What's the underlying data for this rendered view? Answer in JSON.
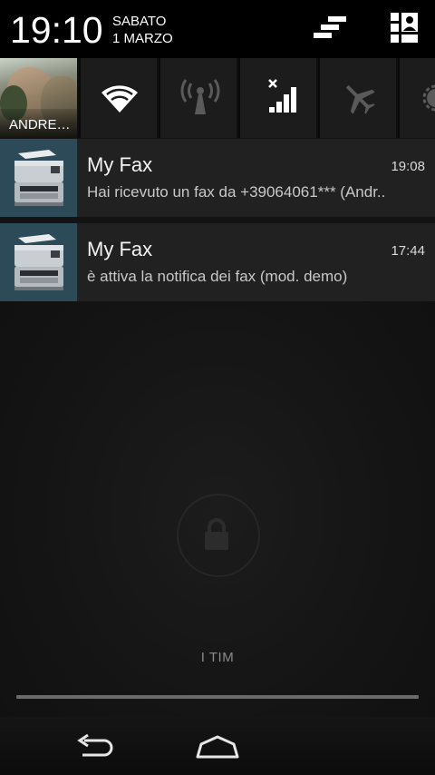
{
  "status_header": {
    "time": "19:10",
    "day": "SABATO",
    "date": "1 MARZO"
  },
  "quick_settings": {
    "user_label": "ANDRE…",
    "tiles": [
      {
        "name": "wifi",
        "icon": "wifi-icon"
      },
      {
        "name": "mobile-data",
        "icon": "antenna-icon"
      },
      {
        "name": "signal",
        "icon": "signal-icon"
      },
      {
        "name": "airplane",
        "icon": "airplane-icon"
      },
      {
        "name": "brightness",
        "icon": "brightness-icon"
      }
    ]
  },
  "notifications": [
    {
      "app": "My Fax",
      "time": "19:08",
      "text": "Hai ricevuto un fax da +39064061*** (Andr..",
      "icon": "fax-machine-icon"
    },
    {
      "app": "My Fax",
      "time": "17:44",
      "text": "è attiva la notifica dei fax (mod. demo)",
      "icon": "fax-machine-icon"
    }
  ],
  "lock_screen": {
    "carrier": "I TIM"
  },
  "colors": {
    "notification_bg": "#212121",
    "icon_bg": "#2c4a58",
    "header_bg": "#000000"
  }
}
